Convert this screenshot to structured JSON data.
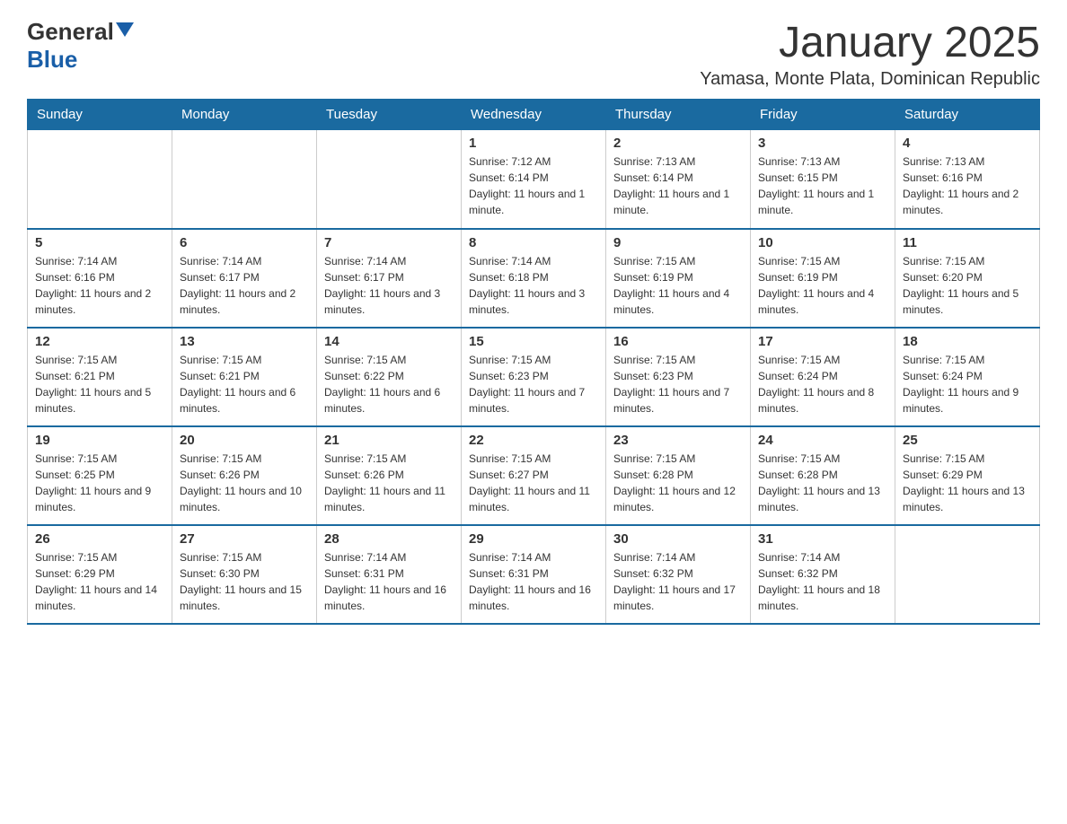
{
  "header": {
    "logo_general": "General",
    "logo_blue": "Blue",
    "month_title": "January 2025",
    "location": "Yamasa, Monte Plata, Dominican Republic"
  },
  "days_of_week": [
    "Sunday",
    "Monday",
    "Tuesday",
    "Wednesday",
    "Thursday",
    "Friday",
    "Saturday"
  ],
  "weeks": [
    [
      {
        "day": "",
        "info": ""
      },
      {
        "day": "",
        "info": ""
      },
      {
        "day": "",
        "info": ""
      },
      {
        "day": "1",
        "info": "Sunrise: 7:12 AM\nSunset: 6:14 PM\nDaylight: 11 hours and 1 minute."
      },
      {
        "day": "2",
        "info": "Sunrise: 7:13 AM\nSunset: 6:14 PM\nDaylight: 11 hours and 1 minute."
      },
      {
        "day": "3",
        "info": "Sunrise: 7:13 AM\nSunset: 6:15 PM\nDaylight: 11 hours and 1 minute."
      },
      {
        "day": "4",
        "info": "Sunrise: 7:13 AM\nSunset: 6:16 PM\nDaylight: 11 hours and 2 minutes."
      }
    ],
    [
      {
        "day": "5",
        "info": "Sunrise: 7:14 AM\nSunset: 6:16 PM\nDaylight: 11 hours and 2 minutes."
      },
      {
        "day": "6",
        "info": "Sunrise: 7:14 AM\nSunset: 6:17 PM\nDaylight: 11 hours and 2 minutes."
      },
      {
        "day": "7",
        "info": "Sunrise: 7:14 AM\nSunset: 6:17 PM\nDaylight: 11 hours and 3 minutes."
      },
      {
        "day": "8",
        "info": "Sunrise: 7:14 AM\nSunset: 6:18 PM\nDaylight: 11 hours and 3 minutes."
      },
      {
        "day": "9",
        "info": "Sunrise: 7:15 AM\nSunset: 6:19 PM\nDaylight: 11 hours and 4 minutes."
      },
      {
        "day": "10",
        "info": "Sunrise: 7:15 AM\nSunset: 6:19 PM\nDaylight: 11 hours and 4 minutes."
      },
      {
        "day": "11",
        "info": "Sunrise: 7:15 AM\nSunset: 6:20 PM\nDaylight: 11 hours and 5 minutes."
      }
    ],
    [
      {
        "day": "12",
        "info": "Sunrise: 7:15 AM\nSunset: 6:21 PM\nDaylight: 11 hours and 5 minutes."
      },
      {
        "day": "13",
        "info": "Sunrise: 7:15 AM\nSunset: 6:21 PM\nDaylight: 11 hours and 6 minutes."
      },
      {
        "day": "14",
        "info": "Sunrise: 7:15 AM\nSunset: 6:22 PM\nDaylight: 11 hours and 6 minutes."
      },
      {
        "day": "15",
        "info": "Sunrise: 7:15 AM\nSunset: 6:23 PM\nDaylight: 11 hours and 7 minutes."
      },
      {
        "day": "16",
        "info": "Sunrise: 7:15 AM\nSunset: 6:23 PM\nDaylight: 11 hours and 7 minutes."
      },
      {
        "day": "17",
        "info": "Sunrise: 7:15 AM\nSunset: 6:24 PM\nDaylight: 11 hours and 8 minutes."
      },
      {
        "day": "18",
        "info": "Sunrise: 7:15 AM\nSunset: 6:24 PM\nDaylight: 11 hours and 9 minutes."
      }
    ],
    [
      {
        "day": "19",
        "info": "Sunrise: 7:15 AM\nSunset: 6:25 PM\nDaylight: 11 hours and 9 minutes."
      },
      {
        "day": "20",
        "info": "Sunrise: 7:15 AM\nSunset: 6:26 PM\nDaylight: 11 hours and 10 minutes."
      },
      {
        "day": "21",
        "info": "Sunrise: 7:15 AM\nSunset: 6:26 PM\nDaylight: 11 hours and 11 minutes."
      },
      {
        "day": "22",
        "info": "Sunrise: 7:15 AM\nSunset: 6:27 PM\nDaylight: 11 hours and 11 minutes."
      },
      {
        "day": "23",
        "info": "Sunrise: 7:15 AM\nSunset: 6:28 PM\nDaylight: 11 hours and 12 minutes."
      },
      {
        "day": "24",
        "info": "Sunrise: 7:15 AM\nSunset: 6:28 PM\nDaylight: 11 hours and 13 minutes."
      },
      {
        "day": "25",
        "info": "Sunrise: 7:15 AM\nSunset: 6:29 PM\nDaylight: 11 hours and 13 minutes."
      }
    ],
    [
      {
        "day": "26",
        "info": "Sunrise: 7:15 AM\nSunset: 6:29 PM\nDaylight: 11 hours and 14 minutes."
      },
      {
        "day": "27",
        "info": "Sunrise: 7:15 AM\nSunset: 6:30 PM\nDaylight: 11 hours and 15 minutes."
      },
      {
        "day": "28",
        "info": "Sunrise: 7:14 AM\nSunset: 6:31 PM\nDaylight: 11 hours and 16 minutes."
      },
      {
        "day": "29",
        "info": "Sunrise: 7:14 AM\nSunset: 6:31 PM\nDaylight: 11 hours and 16 minutes."
      },
      {
        "day": "30",
        "info": "Sunrise: 7:14 AM\nSunset: 6:32 PM\nDaylight: 11 hours and 17 minutes."
      },
      {
        "day": "31",
        "info": "Sunrise: 7:14 AM\nSunset: 6:32 PM\nDaylight: 11 hours and 18 minutes."
      },
      {
        "day": "",
        "info": ""
      }
    ]
  ]
}
